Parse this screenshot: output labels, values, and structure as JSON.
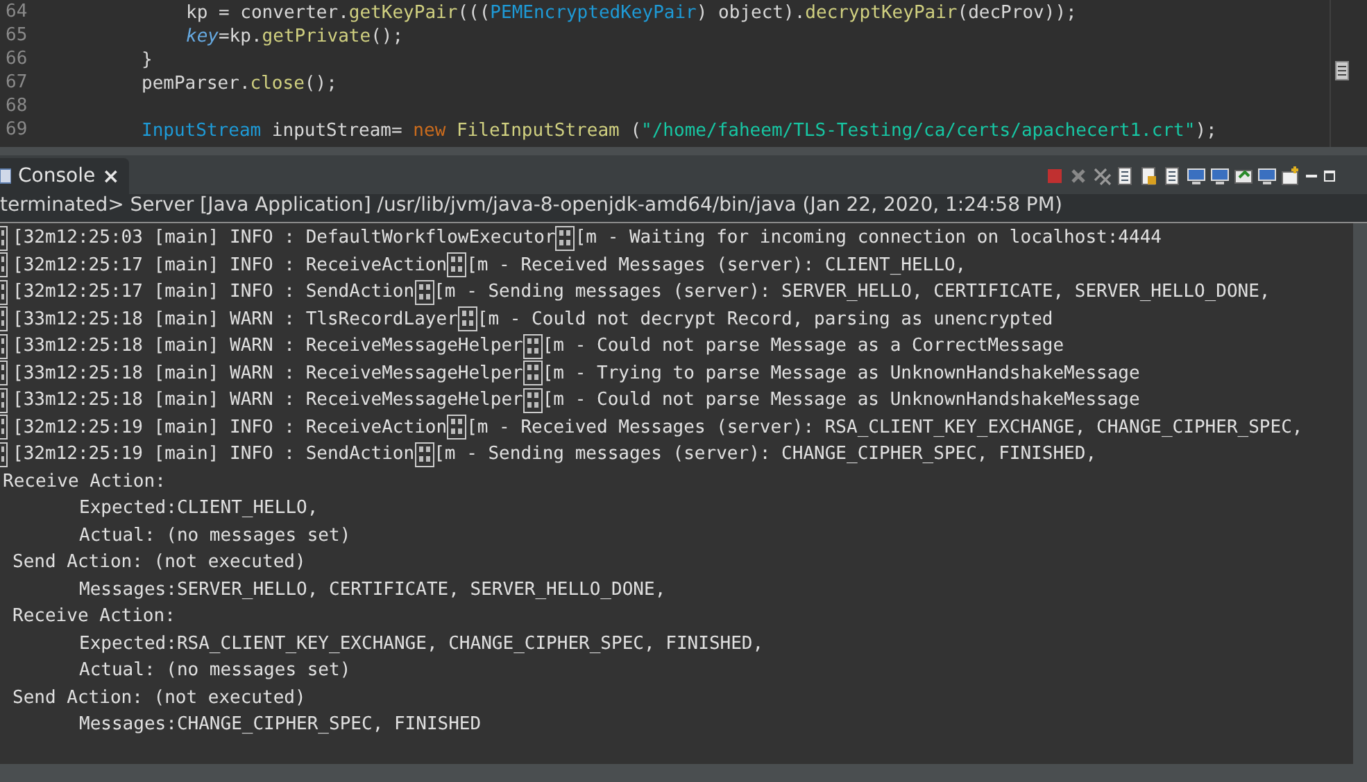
{
  "editor": {
    "lines": [
      {
        "number": "64",
        "kind": "inner",
        "tokens": [
          {
            "kind": "plain",
            "text": "kp = converter."
          },
          {
            "kind": "method",
            "text": "getKeyPair"
          },
          {
            "kind": "plain",
            "text": "((("
          },
          {
            "kind": "type",
            "text": "PEMEncryptedKeyPair"
          },
          {
            "kind": "plain",
            "text": ") object)."
          },
          {
            "kind": "method",
            "text": "decryptKeyPair"
          },
          {
            "kind": "plain",
            "text": "(decProv));"
          }
        ]
      },
      {
        "number": "65",
        "kind": "inner",
        "tokens": [
          {
            "kind": "field",
            "text": "key"
          },
          {
            "kind": "plain",
            "text": "=kp."
          },
          {
            "kind": "method",
            "text": "getPrivate"
          },
          {
            "kind": "plain",
            "text": "();"
          }
        ]
      },
      {
        "number": "66",
        "kind": "outer",
        "tokens": [
          {
            "kind": "plain",
            "text": "}"
          }
        ]
      },
      {
        "number": "67",
        "kind": "outer",
        "tokens": [
          {
            "kind": "plain",
            "text": "pemParser."
          },
          {
            "kind": "method",
            "text": "close"
          },
          {
            "kind": "plain",
            "text": "();"
          }
        ]
      },
      {
        "number": "68",
        "kind": "outer"
      },
      {
        "number": "69",
        "kind": "outer",
        "tokens": [
          {
            "kind": "type",
            "text": "InputStream"
          },
          {
            "kind": "plain",
            "text": " inputStream= "
          },
          {
            "kind": "keyword",
            "text": "new"
          },
          {
            "kind": "method",
            "text": "FileInputStream"
          },
          {
            "kind": "plain",
            "text": " ("
          },
          {
            "kind": "string",
            "text": "\"/home/faheem/TLS-Testing/ca/certs/apachecert1.crt\""
          },
          {
            "kind": "plain",
            "text": ");"
          }
        ]
      }
    ]
  },
  "console": {
    "tab": {
      "label": "Console",
      "close": "×"
    },
    "status": "terminated> Server [Java Application] /usr/lib/jvm/java-8-openjdk-amd64/bin/java (Jan 22, 2020, 1:24:58 PM)",
    "lines": [
      {
        "kind": "log",
        "head": "[32m12:25:03 [main] INFO : DefaultWorkflowExecutor",
        "tail": "[m - Waiting for incoming connection on localhost:4444"
      },
      {
        "kind": "log",
        "head": "[32m12:25:17 [main] INFO : ReceiveAction",
        "tail": "[m - Received Messages (server): CLIENT_HELLO,"
      },
      {
        "kind": "log",
        "head": "[32m12:25:17 [main] INFO : SendAction",
        "tail": "[m - Sending messages (server): SERVER_HELLO, CERTIFICATE, SERVER_HELLO_DONE,"
      },
      {
        "kind": "log",
        "head": "[33m12:25:18 [main] WARN : TlsRecordLayer",
        "tail": "[m - Could not decrypt Record, parsing as unencrypted"
      },
      {
        "kind": "log",
        "head": "[33m12:25:18 [main] WARN : ReceiveMessageHelper",
        "tail": "[m - Could not parse Message as a CorrectMessage"
      },
      {
        "kind": "log",
        "head": "[33m12:25:18 [main] WARN : ReceiveMessageHelper",
        "tail": "[m - Trying to parse Message as UnknownHandshakeMessage"
      },
      {
        "kind": "log",
        "head": "[33m12:25:18 [main] WARN : ReceiveMessageHelper",
        "tail": "[m - Could not parse Message as UnknownHandshakeMessage"
      },
      {
        "kind": "log",
        "head": "[32m12:25:19 [main] INFO : ReceiveAction",
        "tail": "[m - Received Messages (server): RSA_CLIENT_KEY_EXCHANGE, CHANGE_CIPHER_SPEC,"
      },
      {
        "kind": "log",
        "head": "[32m12:25:19 [main] INFO : SendAction",
        "tail": "[m - Sending messages (server): CHANGE_CIPHER_SPEC, FINISHED,"
      },
      {
        "kind": "header",
        "text": "Receive Action:"
      },
      {
        "kind": "detail",
        "text": "Expected:CLIENT_HELLO,"
      },
      {
        "kind": "detail",
        "text": "Actual: (no messages set)"
      },
      {
        "kind": "action",
        "text": "Send Action: (not executed)"
      },
      {
        "kind": "detail",
        "text": "Messages:SERVER_HELLO, CERTIFICATE, SERVER_HELLO_DONE,"
      },
      {
        "kind": "action",
        "text": "Receive Action:"
      },
      {
        "kind": "detail",
        "text": "Expected:RSA_CLIENT_KEY_EXCHANGE, CHANGE_CIPHER_SPEC, FINISHED,"
      },
      {
        "kind": "detail",
        "text": "Actual: (no messages set)"
      },
      {
        "kind": "action",
        "text": "Send Action: (not executed)"
      },
      {
        "kind": "detail",
        "text": "Messages:CHANGE_CIPHER_SPEC, FINISHED"
      }
    ]
  }
}
